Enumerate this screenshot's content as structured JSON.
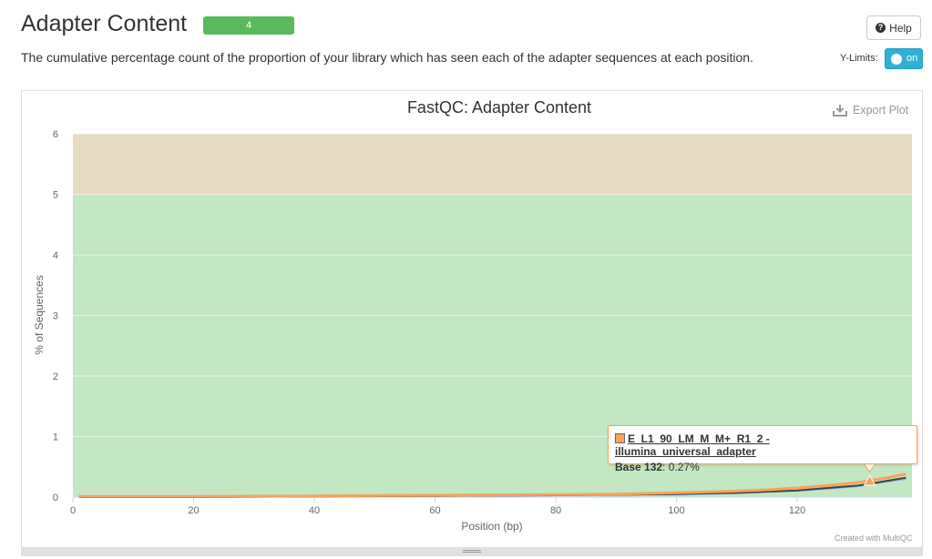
{
  "header": {
    "title": "Adapter Content",
    "badge": "4",
    "description": "The cumulative percentage count of the proportion of your library which has seen each of the adapter sequences at each position.",
    "help_label": "Help",
    "ylimits_label": "Y-Limits:",
    "toggle_label": "on"
  },
  "colors": {
    "pass_band": "#c3e6c3",
    "warn_band": "#e6dcc3",
    "badge": "#5cb85c",
    "toggle": "#31b0d5",
    "series_orange": "#f7a35c",
    "series_dark": "#434348",
    "series_blue": "#7cb5ec"
  },
  "plot": {
    "export_label": "Export Plot",
    "credit": "Created with MultiQC"
  },
  "chart_data": {
    "type": "line",
    "title": "FastQC: Adapter Content",
    "xlabel": "Position (bp)",
    "ylabel": "% of Sequences",
    "xlim": [
      0,
      139
    ],
    "ylim": [
      0,
      6
    ],
    "xticks": [
      0,
      20,
      40,
      60,
      80,
      100,
      120
    ],
    "yticks": [
      0,
      1,
      2,
      3,
      4,
      5,
      6
    ],
    "bands": [
      {
        "from": 0,
        "to": 5,
        "color": "#c3e6c3"
      },
      {
        "from": 5,
        "to": 6,
        "color": "#e6dcc3"
      }
    ],
    "series": [
      {
        "name": "E_L1_90_LM_M_M+_R1_2 - illumina_universal_adapter",
        "color": "#f7a35c",
        "x": [
          1,
          20,
          40,
          60,
          80,
          90,
          100,
          110,
          115,
          120,
          125,
          130,
          132,
          135,
          138
        ],
        "y": [
          0.01,
          0.01,
          0.02,
          0.03,
          0.04,
          0.05,
          0.07,
          0.1,
          0.12,
          0.15,
          0.19,
          0.24,
          0.27,
          0.32,
          0.38
        ]
      },
      {
        "name": "",
        "color": "#434348",
        "x": [
          1,
          20,
          40,
          60,
          80,
          90,
          100,
          110,
          115,
          120,
          125,
          130,
          132,
          135,
          138
        ],
        "y": [
          0.0,
          0.0,
          0.01,
          0.02,
          0.03,
          0.04,
          0.05,
          0.07,
          0.09,
          0.11,
          0.15,
          0.19,
          0.22,
          0.27,
          0.32
        ]
      },
      {
        "name": "",
        "color": "#7cb5ec",
        "x": [
          1,
          20,
          40,
          60,
          80,
          90,
          100,
          110,
          115,
          120,
          125,
          130,
          132,
          135,
          138
        ],
        "y": [
          0.0,
          0.0,
          0.01,
          0.02,
          0.03,
          0.035,
          0.045,
          0.065,
          0.085,
          0.105,
          0.14,
          0.18,
          0.21,
          0.26,
          0.3
        ]
      }
    ],
    "tooltip": {
      "series": "E_L1_90_LM_M_M+_R1_2 - illumina_universal_adapter",
      "x_label": "Base 132",
      "y_text": ": 0.27%",
      "x": 132,
      "y": 0.27
    }
  }
}
